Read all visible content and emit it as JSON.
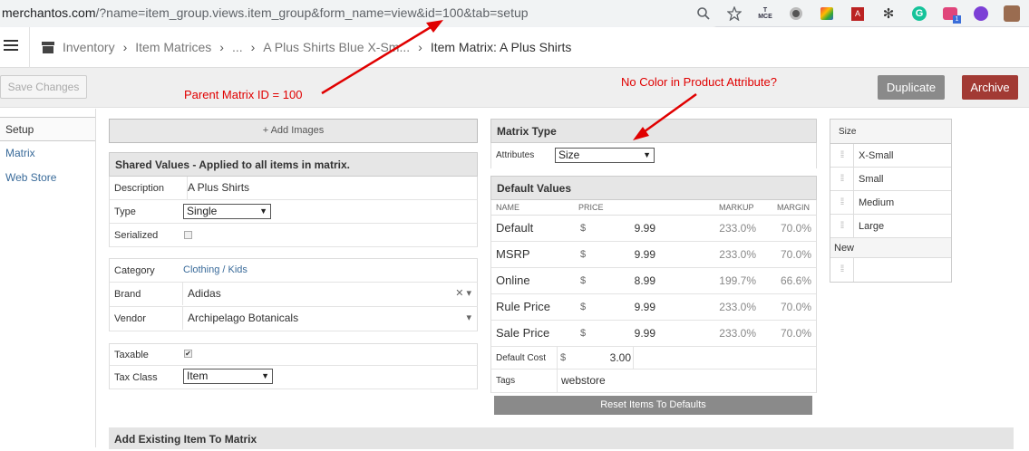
{
  "browser": {
    "url_host": "merchantos.com",
    "url_path": "/?name=item_group.views.item_group&form_name=view&id=100&tab=setup"
  },
  "breadcrumb": {
    "items": [
      "Inventory",
      "Item Matrices",
      "...",
      "A Plus Shirts Blue X-Sm..."
    ],
    "current": "Item Matrix:  A Plus Shirts"
  },
  "toolbar": {
    "save_label": "Save Changes",
    "duplicate_label": "Duplicate",
    "archive_label": "Archive"
  },
  "sidebar": {
    "items": [
      {
        "label": "Setup",
        "active": true
      },
      {
        "label": "Matrix",
        "active": false
      },
      {
        "label": "Web Store",
        "active": false
      }
    ]
  },
  "add_images_label": "+ Add Images",
  "shared": {
    "title": "Shared Values - Applied to all items in matrix.",
    "description_label": "Description",
    "description_value": "A Plus Shirts",
    "type_label": "Type",
    "type_value": "Single",
    "serialized_label": "Serialized",
    "category_label": "Category",
    "category_value": "Clothing / Kids",
    "brand_label": "Brand",
    "brand_value": "Adidas",
    "vendor_label": "Vendor",
    "vendor_value": "Archipelago Botanicals",
    "taxable_label": "Taxable",
    "taxable_check": "✔",
    "taxclass_label": "Tax Class",
    "taxclass_value": "Item"
  },
  "matrix_type": {
    "title": "Matrix Type",
    "attributes_label": "Attributes",
    "attributes_value": "Size"
  },
  "default_values": {
    "title": "Default Values",
    "headers": {
      "name": "NAME",
      "price": "PRICE",
      "markup": "MARKUP",
      "margin": "MARGIN"
    },
    "currency": "$",
    "rows": [
      {
        "name": "Default",
        "price": "9.99",
        "markup": "233.0%",
        "margin": "70.0%"
      },
      {
        "name": "MSRP",
        "price": "9.99",
        "markup": "233.0%",
        "margin": "70.0%"
      },
      {
        "name": "Online",
        "price": "8.99",
        "markup": "199.7%",
        "margin": "66.6%"
      },
      {
        "name": "Rule Price",
        "price": "9.99",
        "markup": "233.0%",
        "margin": "70.0%"
      },
      {
        "name": "Sale Price",
        "price": "9.99",
        "markup": "233.0%",
        "margin": "70.0%"
      }
    ],
    "cost_label": "Default Cost",
    "cost_value": "3.00",
    "tags_label": "Tags",
    "tags_value": "webstore",
    "reset_label": "Reset Items To Defaults"
  },
  "size_table": {
    "header": "Size",
    "values": [
      "X-Small",
      "Small",
      "Medium",
      "Large"
    ],
    "new_label": "New"
  },
  "add_existing_label": "Add Existing Item To Matrix",
  "annotations": {
    "parent_id": "Parent Matrix ID = 100",
    "no_color": "No Color in Product Attribute?",
    "color": "#e00000"
  }
}
